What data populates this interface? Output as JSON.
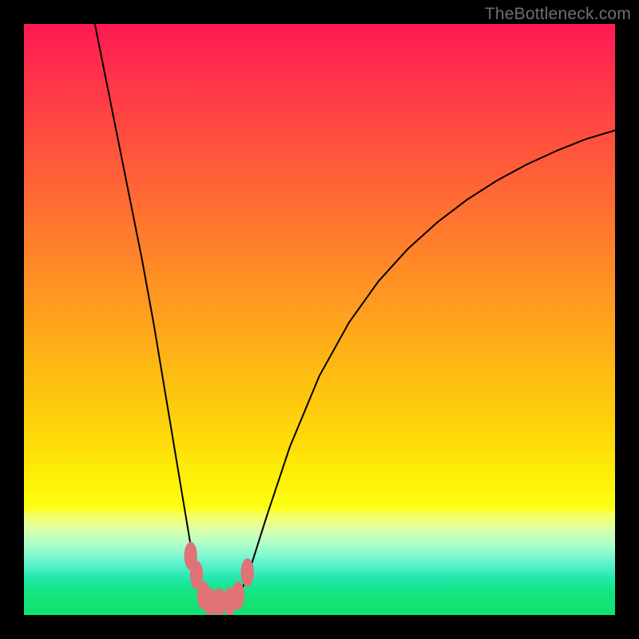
{
  "watermark": "TheBottleneck.com",
  "colors": {
    "black": "#000000",
    "curve": "#000000",
    "marker": "#e17277",
    "gradient": {
      "g0": "#fe1a54",
      "g10": "#ff3549",
      "g20": "#ff513e",
      "g30": "#ff6c33",
      "g40": "#ff8728",
      "g50": "#ffa21d",
      "g60": "#febe12",
      "g70": "#fed90a",
      "g77": "#fdf205",
      "g82": "#fdff17",
      "g83": "#f5ff60",
      "g84": "#eaff8e",
      "g86": "#d2ffb4",
      "g88": "#aeffca",
      "g90": "#7ef8cf",
      "g92": "#4eefc6",
      "g93_5": "#27e8b3",
      "g95": "#17e694",
      "g97": "#14e478",
      "g100": "#12e270"
    }
  },
  "chart_data": {
    "type": "line",
    "title": "",
    "xlabel": "",
    "ylabel": "",
    "xlim": [
      0,
      100
    ],
    "ylim": [
      0,
      100
    ],
    "annotations": [
      "TheBottleneck.com"
    ],
    "series": [
      {
        "name": "bottleneck-curve-left",
        "x": [
          12,
          14,
          16,
          18,
          20,
          22,
          24,
          25.5,
          27,
          28.5,
          29.5,
          30.5
        ],
        "y": [
          100,
          90,
          80,
          70,
          60,
          49,
          37,
          28,
          19,
          10,
          5.5,
          2.4
        ]
      },
      {
        "name": "bottleneck-flat",
        "x": [
          30.5,
          31.5,
          33.0,
          34.5,
          36.0
        ],
        "y": [
          2.4,
          2.2,
          2.2,
          2.2,
          2.4
        ]
      },
      {
        "name": "bottleneck-curve-right",
        "x": [
          36.0,
          38,
          41,
          45,
          50,
          55,
          60,
          65,
          70,
          75,
          80,
          85,
          90,
          95,
          100
        ],
        "y": [
          2.4,
          7.0,
          16.5,
          28.5,
          40.5,
          49.5,
          56.5,
          62.0,
          66.5,
          70.3,
          73.5,
          76.2,
          78.5,
          80.5,
          82.0
        ]
      }
    ],
    "markers": [
      {
        "name": "left-upper-1",
        "x": 28.2,
        "y": 10.0
      },
      {
        "name": "left-upper-2",
        "x": 29.2,
        "y": 6.8
      },
      {
        "name": "left-low",
        "x": 30.4,
        "y": 3.3
      },
      {
        "name": "flat-left",
        "x": 31.5,
        "y": 2.2
      },
      {
        "name": "flat-mid",
        "x": 33.0,
        "y": 2.2
      },
      {
        "name": "flat-right",
        "x": 34.8,
        "y": 2.3
      },
      {
        "name": "right-low",
        "x": 36.2,
        "y": 3.3
      },
      {
        "name": "right-upper",
        "x": 37.8,
        "y": 7.2
      }
    ],
    "marker_size": {
      "rx": 1.1,
      "ry": 2.4
    }
  }
}
